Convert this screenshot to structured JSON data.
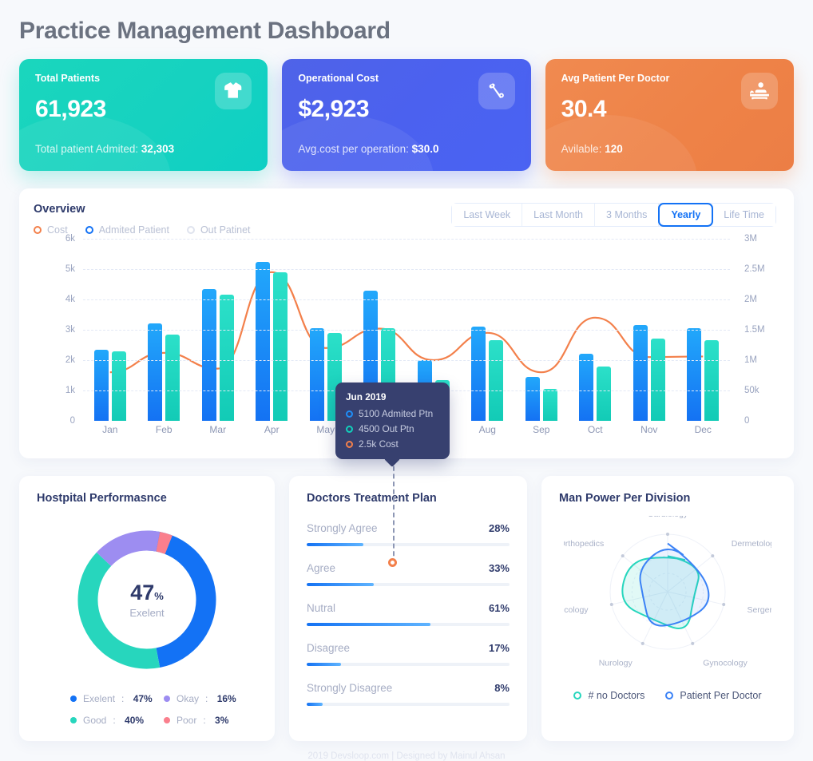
{
  "header": {
    "title": "Practice Management Dashboard"
  },
  "kpi_cards": [
    {
      "label": "Total Patients",
      "value": "61,923",
      "sub_prefix": "Total patient Admited: ",
      "sub_value": "32,303",
      "icon": "doctor-coat-icon",
      "color": "#16d2c0"
    },
    {
      "label": "Operational Cost",
      "value": "$2,923",
      "sub_prefix": "Avg.cost per operation: ",
      "sub_value": "$30.0",
      "icon": "scissors-icon",
      "color": "#4b61ef"
    },
    {
      "label": "Avg Patient Per Doctor",
      "value": "30.4",
      "sub_prefix": "Avilable: ",
      "sub_value": "120",
      "icon": "doctor-desk-icon",
      "color": "#ee8247"
    }
  ],
  "overview": {
    "title": "Overview",
    "legend": [
      {
        "label": "Cost",
        "color": "#f3804b"
      },
      {
        "label": "Admited Patient",
        "color": "#1372f5"
      },
      {
        "label": "Out Patinet",
        "color": "#dfe3ee"
      }
    ],
    "range_buttons": [
      {
        "label": "Last Week",
        "active": false
      },
      {
        "label": "Last Month",
        "active": false
      },
      {
        "label": "3 Months",
        "active": false
      },
      {
        "label": "Yearly",
        "active": true
      },
      {
        "label": "Life Time",
        "active": false
      }
    ],
    "tooltip": {
      "title": "Jun 2019",
      "rows": [
        {
          "text": "5100 Admited Ptn",
          "color": "#1f8ef8"
        },
        {
          "text": "4500 Out Ptn",
          "color": "#11d0bb"
        },
        {
          "text": "2.5k Cost",
          "color": "#f3804b"
        }
      ]
    }
  },
  "chart_data": {
    "type": "bar",
    "title": "Overview",
    "categories": [
      "Jan",
      "Feb",
      "Mar",
      "Apr",
      "May",
      "Jun",
      "Jul",
      "Aug",
      "Sep",
      "Oct",
      "Nov",
      "Dec"
    ],
    "series": [
      {
        "name": "Admited Patient",
        "type": "bar",
        "color": "#1472f3",
        "axis": "left",
        "values": [
          2350,
          3200,
          4350,
          5250,
          3050,
          4300,
          2000,
          3100,
          1450,
          2200,
          3150,
          3050
        ]
      },
      {
        "name": "Out Patinet",
        "type": "bar",
        "color": "#12cbb6",
        "axis": "left",
        "values": [
          2300,
          2850,
          4150,
          4900,
          2900,
          3050,
          1350,
          2650,
          1050,
          1800,
          2700,
          2650
        ]
      },
      {
        "name": "Cost",
        "type": "line",
        "color": "#f3804b",
        "axis": "right",
        "values": [
          800000,
          1120000,
          860000,
          2450000,
          1200000,
          1520000,
          1000000,
          1450000,
          800000,
          1700000,
          1050000,
          1060000
        ]
      }
    ],
    "yaxis_left": {
      "ticks": [
        "0",
        "1k",
        "2k",
        "3k",
        "4k",
        "5k",
        "6k"
      ],
      "min": 0,
      "max": 6000
    },
    "yaxis_right": {
      "ticks": [
        "0",
        "50k",
        "1M",
        "1.5M",
        "2M",
        "2.5M",
        "3M"
      ],
      "min": 0,
      "max": 3000000
    },
    "xlabel": "",
    "ylabel": "",
    "grid": true,
    "legend_position": "top-left"
  },
  "hospital_performance": {
    "title": "Hostpital Performasnce",
    "center_value": "47",
    "center_unit": "%",
    "center_label": "Exelent",
    "chart_data": {
      "type": "pie",
      "title": "Hostpital Performasnce",
      "categories": [
        "Exelent",
        "Good",
        "Okay",
        "Poor"
      ],
      "values": [
        47,
        40,
        16,
        3
      ],
      "colors": [
        "#1372f5",
        "#27d6bd",
        "#9d8df1",
        "#fa7f8d"
      ]
    },
    "legend": [
      {
        "label": "Exelent",
        "value": "47%",
        "color": "#1372f5"
      },
      {
        "label": "Okay",
        "value": "16%",
        "color": "#9d8df1"
      },
      {
        "label": "Good",
        "value": "40%",
        "color": "#27d6bd"
      },
      {
        "label": "Poor",
        "value": "3%",
        "color": "#fa7f8d"
      }
    ]
  },
  "treatment_plan": {
    "title": "Doctors Treatment Plan",
    "chart_data": {
      "type": "bar",
      "title": "Doctors Treatment Plan",
      "categories": [
        "Strongly Agree",
        "Agree",
        "Nutral",
        "Disagree",
        "Strongly Disagree"
      ],
      "values": [
        28,
        33,
        61,
        17,
        8
      ],
      "ylim": [
        0,
        100
      ],
      "ylabel": "%"
    },
    "rows": [
      {
        "label": "Strongly Agree",
        "value": "28%",
        "pct": 28
      },
      {
        "label": "Agree",
        "value": "33%",
        "pct": 33
      },
      {
        "label": "Nutral",
        "value": "61%",
        "pct": 61
      },
      {
        "label": "Disagree",
        "value": "17%",
        "pct": 17
      },
      {
        "label": "Strongly Disagree",
        "value": "8%",
        "pct": 8
      }
    ]
  },
  "man_power": {
    "title": "Man Power Per Division",
    "chart_data": {
      "type": "radar",
      "title": "Man Power Per Division",
      "categories": [
        "Cardiology",
        "Dermetology",
        "Sergery",
        "Gynocology",
        "Nurology",
        "Concology",
        "Orthopedics"
      ],
      "series": [
        {
          "name": "# no Doctors",
          "color": "#27d6bd",
          "values": [
            62,
            78,
            46,
            80,
            55,
            88,
            86
          ]
        },
        {
          "name": "Patient Per Doctor",
          "color": "#3b82f6",
          "values": [
            84,
            70,
            82,
            60,
            70,
            44,
            66
          ]
        }
      ],
      "max": 100
    },
    "axis_labels": [
      "Cardiology",
      "Dermetology",
      "Sergery",
      "Gynocology",
      "Nurology",
      "Concology",
      "Orthopedics"
    ],
    "legend": [
      {
        "label": "# no Doctors",
        "color": "#27d6bd"
      },
      {
        "label": "Patient Per Doctor",
        "color": "#3b82f6"
      }
    ]
  },
  "footer": {
    "text": "2019 Devsloop.com | Designed by Mainul Ahsan"
  }
}
